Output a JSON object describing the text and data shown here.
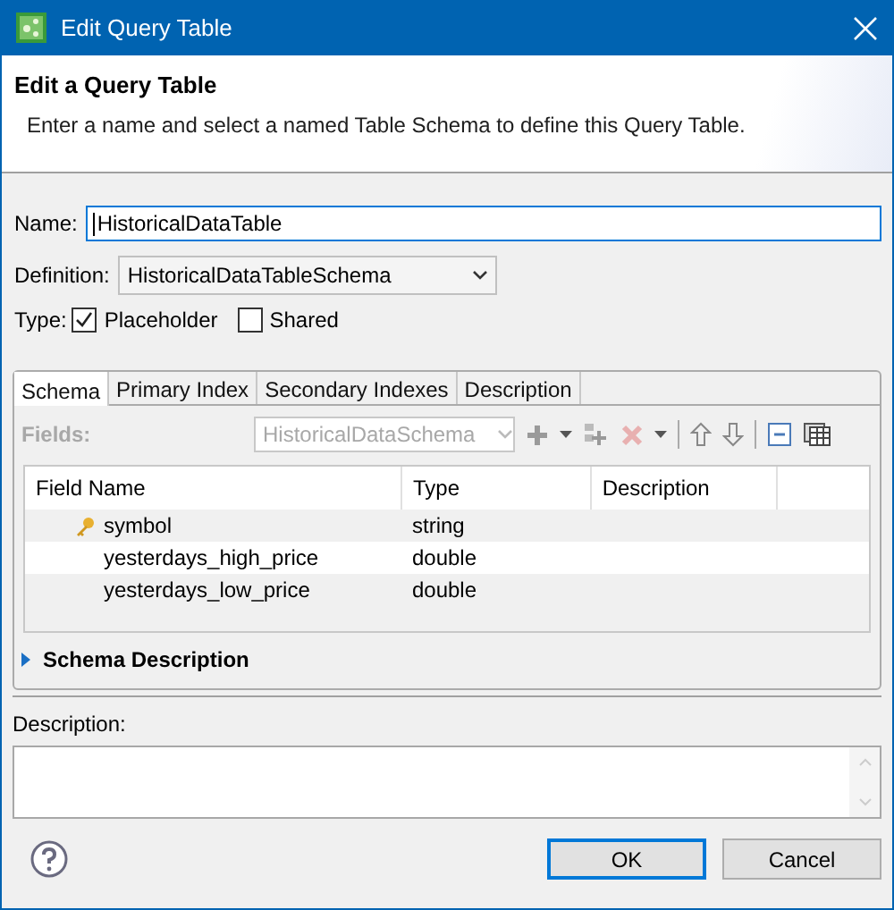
{
  "window": {
    "title": "Edit Query Table"
  },
  "header": {
    "title": "Edit a Query Table",
    "message": "Enter a name and select a named Table Schema to define this Query Table."
  },
  "name": {
    "label": "Name:",
    "value": "HistoricalDataTable"
  },
  "definition": {
    "label": "Definition:",
    "value": "HistoricalDataTableSchema"
  },
  "type": {
    "label": "Type:",
    "options": [
      {
        "label": "Placeholder",
        "checked": true
      },
      {
        "label": "Shared",
        "checked": false
      }
    ]
  },
  "tabs": [
    {
      "label": "Schema",
      "selected": true
    },
    {
      "label": "Primary Index",
      "selected": false
    },
    {
      "label": "Secondary Indexes",
      "selected": false
    },
    {
      "label": "Description",
      "selected": false
    }
  ],
  "fields": {
    "label": "Fields:",
    "value": "HistoricalDataSchema",
    "disabled": true
  },
  "table": {
    "columns": [
      "Field Name",
      "Type",
      "Description"
    ],
    "rows": [
      {
        "field_name": "symbol",
        "type": "string",
        "key": true
      },
      {
        "field_name": "yesterdays_high_price",
        "type": "double",
        "key": false
      },
      {
        "field_name": "yesterdays_low_price",
        "type": "double",
        "key": false
      }
    ]
  },
  "schema_description": {
    "label": "Schema Description",
    "expanded": false
  },
  "description": {
    "label": "Description:"
  },
  "buttons": [
    {
      "label": "OK",
      "default": true
    },
    {
      "label": "Cancel",
      "default": false
    }
  ]
}
